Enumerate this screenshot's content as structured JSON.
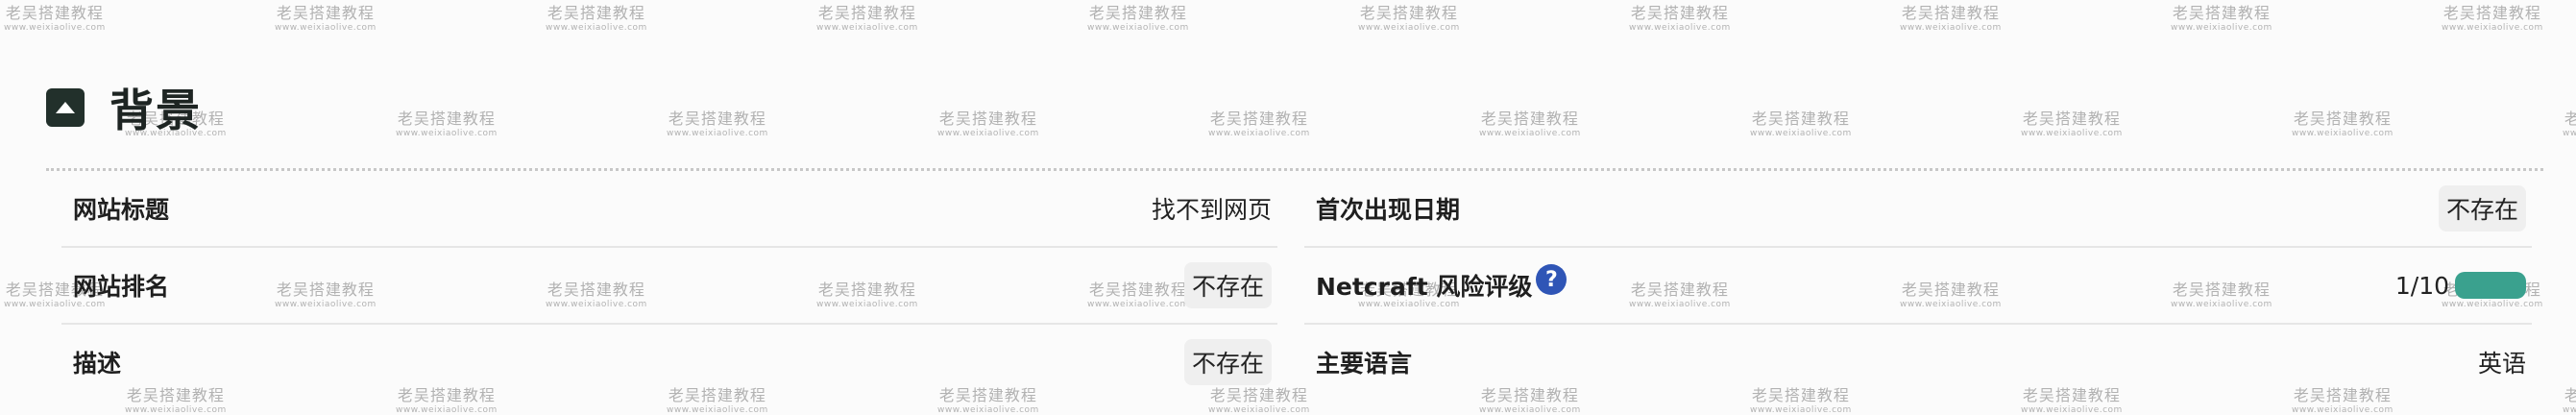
{
  "watermark": {
    "line1": "老吴搭建教程",
    "line2": "www.weixiaolive.com"
  },
  "section": {
    "title": "背景"
  },
  "left_rows": [
    {
      "label": "网站标题",
      "value": "找不到网页"
    },
    {
      "label": "网站排名",
      "value": "不存在"
    },
    {
      "label": "描述",
      "value": "不存在"
    }
  ],
  "right_rows": [
    {
      "label": "首次出现日期",
      "value": "不存在"
    },
    {
      "label": "Netcraft 风险评级",
      "value": "1/10",
      "risk_fraction": 0.1,
      "bar_color": "#3aa18e"
    },
    {
      "label": "主要语言",
      "value": "英语"
    }
  ],
  "colors": {
    "toggle": "#22302b",
    "help": "#2f55b6"
  }
}
